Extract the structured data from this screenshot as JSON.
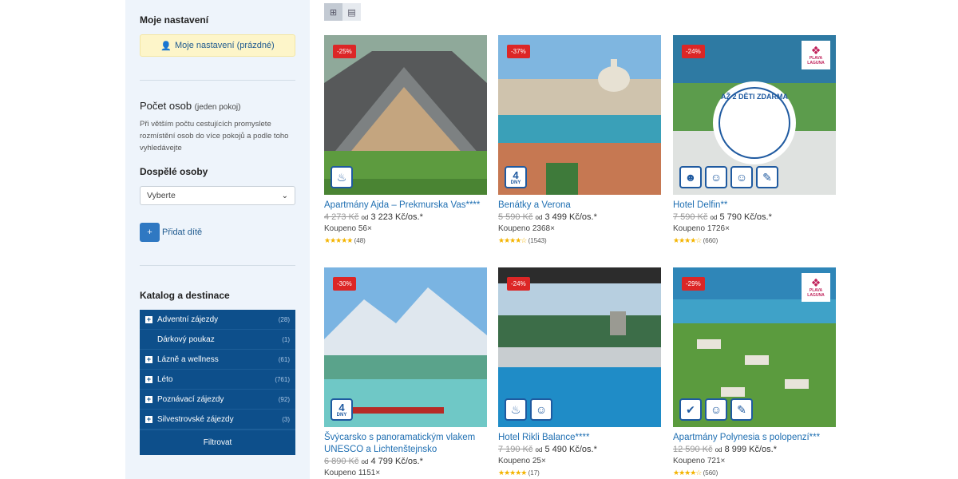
{
  "sidebar": {
    "settings_title": "Moje nastavení",
    "settings_button": "Moje nastavení (prázdné)",
    "persons_title": "Počet osob",
    "persons_sub": "(jeden pokoj)",
    "persons_note": "Při větším počtu cestujících promyslete rozmístění osob do více pokojů a podle toho vyhledávejte",
    "adults_title": "Dospělé osoby",
    "adults_select": "Vyberte",
    "add_child": "Přidat dítě",
    "catalog_title": "Katalog a destinace",
    "catalog": [
      {
        "label": "Adventní zájezdy",
        "count": "(28)",
        "expandable": true
      },
      {
        "label": "Dárkový poukaz",
        "count": "(1)",
        "expandable": false
      },
      {
        "label": "Lázně a wellness",
        "count": "(61)",
        "expandable": true
      },
      {
        "label": "Léto",
        "count": "(761)",
        "expandable": true
      },
      {
        "label": "Poznávací zájezdy",
        "count": "(92)",
        "expandable": true
      },
      {
        "label": "Silvestrovské zájezdy",
        "count": "(3)",
        "expandable": true
      }
    ],
    "filter_button": "Filtrovat"
  },
  "products": [
    {
      "discount": "-25%",
      "title": "Apartmány Ajda – Prekmurska Vas****",
      "old_price": "4 273 Kč",
      "od": "od",
      "price": "3 223 Kč/os.*",
      "bought": "Koupeno 56×",
      "reviews": "(48)",
      "stars": 5,
      "icons": [
        "hotel-icon"
      ]
    },
    {
      "discount": "-37%",
      "title": "Benátky a Verona",
      "old_price": "5 590 Kč",
      "od": "od",
      "price": "3 499 Kč/os.*",
      "bought": "Koupeno 2368×",
      "reviews": "(1543)",
      "stars": 4.5,
      "days": "4",
      "days_label": "DNY"
    },
    {
      "discount": "-24%",
      "title": "Hotel Delfin**",
      "old_price": "7 590 Kč",
      "od": "od",
      "price": "5 790 Kč/os.*",
      "bought": "Koupeno 1726×",
      "reviews": "(660)",
      "stars": 4,
      "brand": "PLAVA LAGUNA",
      "promo": "AŽ 2 DĚTI ZDARMA"
    },
    {
      "discount": "-30%",
      "title": "Švýcarsko s panoramatickým vlakem UNESCO a Lichtenštejnsko",
      "old_price": "6 890 Kč",
      "od": "od",
      "price": "4 799 Kč/os.*",
      "bought": "Koupeno 1151×",
      "reviews": "",
      "stars": 0,
      "days": "4",
      "days_label": "DNY"
    },
    {
      "discount": "-24%",
      "title": "Hotel Rikli Balance****",
      "old_price": "7 190 Kč",
      "od": "od",
      "price": "5 490 Kč/os.*",
      "bought": "Koupeno 25×",
      "reviews": "(17)",
      "stars": 5
    },
    {
      "discount": "-29%",
      "title": "Apartmány Polynesia s polopenzí***",
      "old_price": "12 590 Kč",
      "od": "od",
      "price": "8 999 Kč/os.*",
      "bought": "Koupeno 721×",
      "reviews": "(560)",
      "stars": 4,
      "brand": "PLAVA LAGUNA"
    }
  ]
}
